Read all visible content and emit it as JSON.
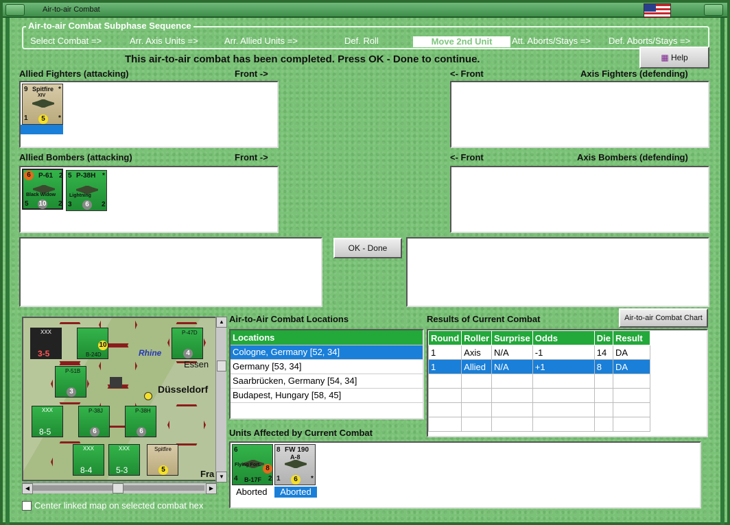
{
  "window": {
    "title": "Air-to-air Combat"
  },
  "sequence": {
    "title": "Air-to-air Combat Subphase Sequence",
    "steps": [
      "Select Combat =>",
      "Arr. Axis Units =>",
      "Arr. Allied Units =>",
      "Def. Roll",
      "Move 2nd Unit",
      "Att. Aborts/Stays =>",
      "Def. Aborts/Stays =>"
    ],
    "active_step": "Move 2nd Unit"
  },
  "status_message": "This air-to-air combat has been completed.  Press OK - Done to continue.",
  "buttons": {
    "help": "Help",
    "ok_done": "OK - Done",
    "combat_chart": "Air-to-air Combat Chart"
  },
  "sections": {
    "allied_fighters": "Allied Fighters (attacking)",
    "allied_bombers": "Allied Bombers (attacking)",
    "axis_fighters": "Axis Fighters (defending)",
    "axis_bombers": "Axis Bombers (defending)",
    "front_right": "Front ->",
    "front_left": "<- Front",
    "locations_title": "Air-to-Air Combat Locations",
    "results_title": "Results of Current Combat",
    "units_affected": "Units Affected by Current Combat"
  },
  "allied_fighters": [
    {
      "name": "Spitfire",
      "variant": "XIV",
      "left": "9",
      "star": "*",
      "bottom_left": "1",
      "value": "5",
      "bottom_right": "*"
    }
  ],
  "allied_bombers": [
    {
      "name": "P-61",
      "variant": "Black Widow",
      "left": "6",
      "star": "2",
      "bottom_left": "5",
      "value": "10",
      "bottom_right": "2"
    },
    {
      "name": "P-38H",
      "variant": "Lightning",
      "left": "5",
      "star": "*",
      "bottom_left": "3",
      "value": "6",
      "bottom_right": "2"
    }
  ],
  "locations": {
    "header": "Locations",
    "items": [
      "Cologne, Germany [52, 34]",
      "Germany [53, 34]",
      "Saarbrücken, Germany [54, 34]",
      "Budapest, Hungary [58, 45]"
    ],
    "selected": 0
  },
  "results": {
    "columns": [
      "Round",
      "Roller",
      "Surprise",
      "Odds",
      "Die",
      "Result"
    ],
    "rows": [
      [
        "1",
        "Axis",
        "N/A",
        "-1",
        "14",
        "DA"
      ],
      [
        "1",
        "Allied",
        "N/A",
        "+1",
        "8",
        "DA"
      ]
    ],
    "selected": 1
  },
  "affected_units": [
    {
      "name": "B-17F",
      "variant": "Flying Fort.",
      "left": "6",
      "bottom_left": "4",
      "value": "8",
      "bottom_right": "2",
      "status": "Aborted"
    },
    {
      "name": "FW 190",
      "variant": "A-8",
      "left": "8",
      "bottom_left": "1",
      "value": "6",
      "bottom_right": "*",
      "status": "Aborted"
    }
  ],
  "map": {
    "labels": [
      "Rhine",
      "Essen",
      "Düsseldorf",
      "Fra"
    ],
    "counters": [
      {
        "top": "XXX",
        "value": "3-5"
      },
      {
        "top": "XXX",
        "value": "8-5"
      },
      {
        "top": "XXX",
        "value": "8-4"
      },
      {
        "top": "XXX",
        "value": "5-3"
      }
    ],
    "air_units": [
      {
        "name": "B-24D",
        "value": "10"
      },
      {
        "name": "P-47D",
        "value": "4"
      },
      {
        "name": "P-51B",
        "value": "3"
      },
      {
        "name": "P-38J",
        "value": "6"
      },
      {
        "name": "P-38H",
        "value": "6"
      },
      {
        "name": "Spitfire",
        "value": "5"
      }
    ]
  },
  "checkbox_label": "Center linked map on selected combat hex"
}
